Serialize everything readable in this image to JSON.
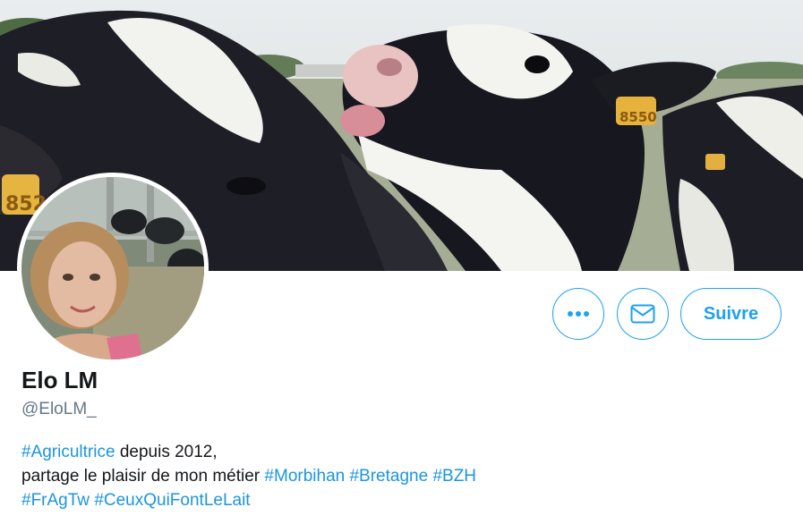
{
  "banner": {
    "ear_tag_left": "852",
    "ear_tag_center": "8550"
  },
  "actions": {
    "more_icon": "more-dots-icon",
    "message_icon": "envelope-icon",
    "follow_label": "Suivre",
    "accent_color": "#1da1f2"
  },
  "profile": {
    "display_name": "Elo LM",
    "handle": "@EloLM_"
  },
  "bio": {
    "tag_agricultrice": "#Agricultrice",
    "text_1": " depuis 2012,",
    "text_2": "partage le plaisir de mon métier ",
    "tag_morbihan": "#Morbihan",
    "tag_bretagne": "#Bretagne",
    "tag_bzh": "#BZH",
    "tag_fragtw": "#FrAgTw",
    "tag_ceuxquifontlelait": "#CeuxQuiFontLeLait",
    "hashtag_color": "#1b95e0"
  }
}
